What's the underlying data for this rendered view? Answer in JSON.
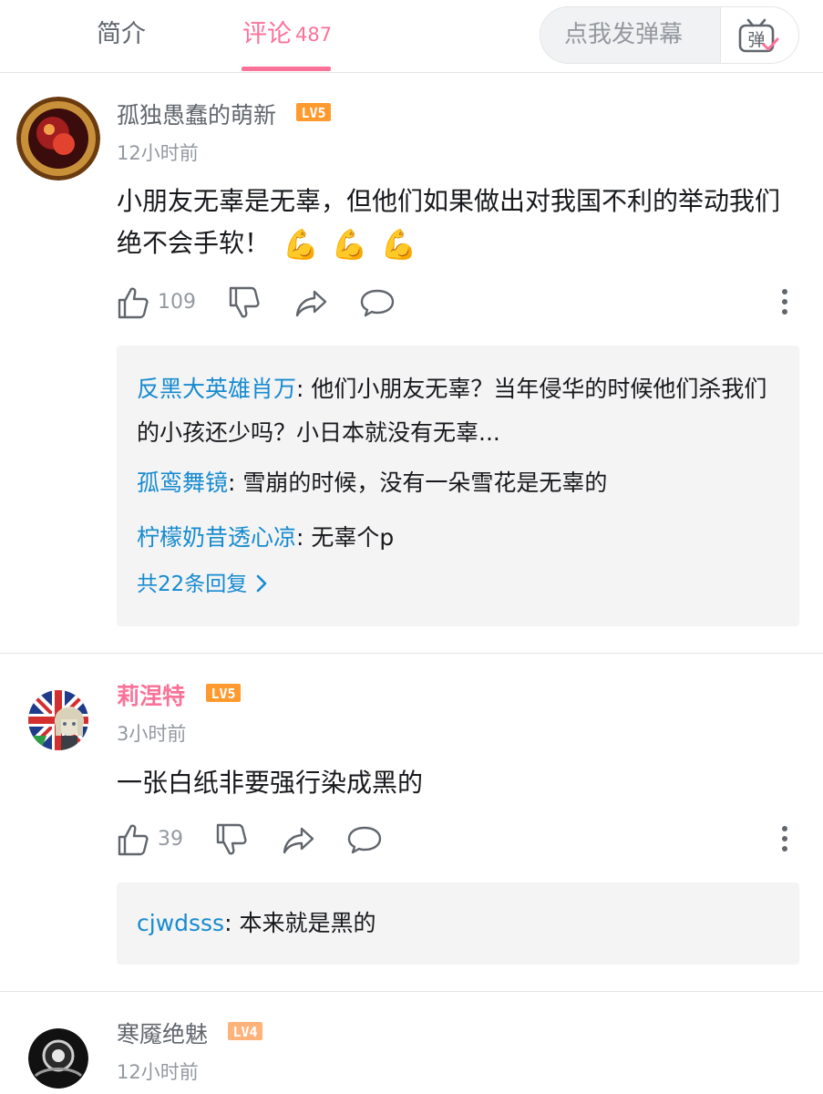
{
  "tabs": {
    "intro": "简介",
    "comments": "评论",
    "comments_count": "487"
  },
  "danmaku": {
    "placeholder": "点我发弹幕",
    "button_label": "弹"
  },
  "comments": [
    {
      "username": "孤独愚蠢的萌新",
      "level": "LV5",
      "time": "12小时前",
      "text": "小朋友无辜是无辜，但他们如果做出对我国不利的举动我们绝不会手软！",
      "emojis": [
        "💪",
        "💪",
        "💪"
      ],
      "likes": "109",
      "replies": [
        {
          "name": "反黑大英雄肖万",
          "text": "他们小朋友无辜？当年侵华的时候他们杀我们的小孩还少吗？小日本就没有无辜..."
        },
        {
          "name": "孤鸾舞镜",
          "text": "雪崩的时候，没有一朵雪花是无辜的"
        },
        {
          "name": "柠檬奶昔透心凉",
          "text": "无辜个p"
        }
      ],
      "reply_more": "共22条回复"
    },
    {
      "username": "莉涅特",
      "level": "LV5",
      "time": "3小时前",
      "text": "一张白纸非要强行染成黑的",
      "likes": "39",
      "replies": [
        {
          "name": "cjwdsss",
          "text": "本来就是黑的"
        }
      ]
    },
    {
      "username": "寒魇绝魅",
      "level": "LV4",
      "time": "12小时前"
    }
  ],
  "colors": {
    "accent": "#fb7299",
    "reply_name": "#178bcf",
    "level5": "#ff9a2e",
    "level4": "#ffb27a"
  }
}
